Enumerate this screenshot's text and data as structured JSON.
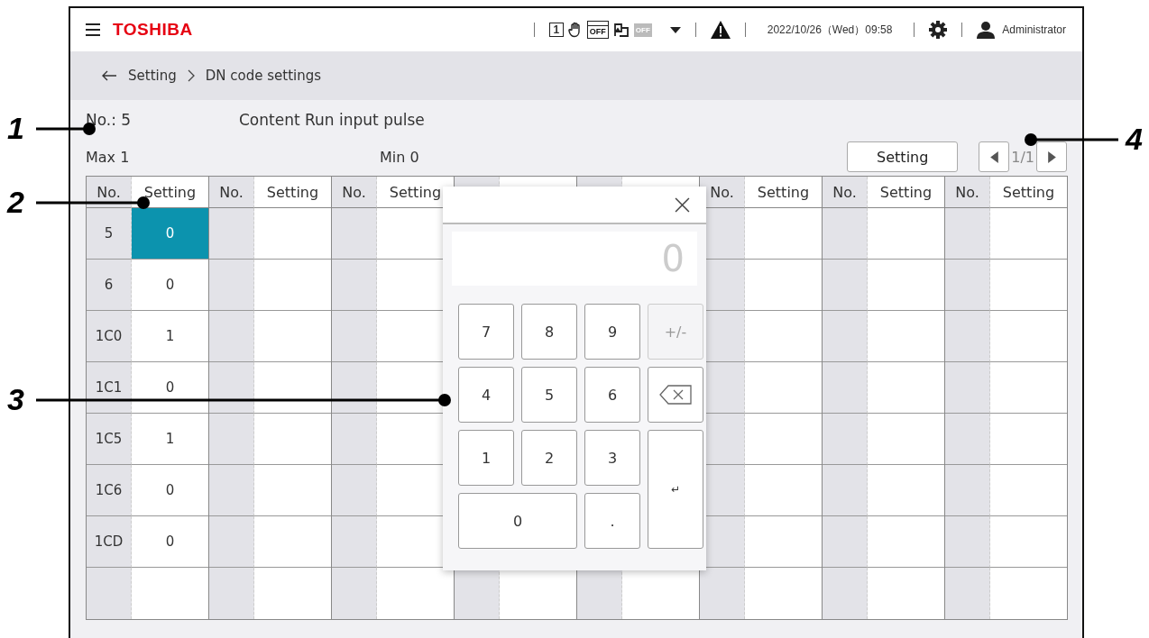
{
  "header": {
    "logo": "TOSHIBA",
    "status_icons": [
      {
        "kind": "number",
        "label": "1"
      },
      {
        "kind": "hand"
      },
      {
        "kind": "calendar",
        "label": "OFF"
      },
      {
        "kind": "schedule"
      },
      {
        "kind": "badge",
        "label": "OFF"
      }
    ],
    "datetime": "2022/10/26（Wed）09:58",
    "user": "Administrator"
  },
  "breadcrumb": [
    "Setting",
    "DN code settings"
  ],
  "info": {
    "number": "No.: 5",
    "content": "Content Run input pulse",
    "max": "Max 1",
    "min": "Min 0",
    "setting_button": "Setting",
    "page": "1/1"
  },
  "columns": [
    {
      "no_header": "No.",
      "setting_header": "Setting",
      "rows": [
        {
          "no": "5",
          "setting": "0",
          "selected": true
        },
        {
          "no": "6",
          "setting": "0",
          "selected": false
        },
        {
          "no": "1C0",
          "setting": "1",
          "selected": false
        },
        {
          "no": "1C1",
          "setting": "0",
          "selected": false
        },
        {
          "no": "1C5",
          "setting": "1",
          "selected": false
        },
        {
          "no": "1C6",
          "setting": "0",
          "selected": false
        },
        {
          "no": "1CD",
          "setting": "0",
          "selected": false
        }
      ]
    },
    {
      "no_header": "No.",
      "setting_header": "Setting"
    },
    {
      "no_header": "No.",
      "setting_header": "Setting"
    },
    {},
    {},
    {
      "no_header": "No.",
      "setting_header": "Setting"
    },
    {
      "no_header": "No.",
      "setting_header": "Setting"
    },
    {
      "no_header": "No.",
      "setting_header": "Setting"
    }
  ],
  "keypad": {
    "display": "0",
    "keys": [
      {
        "kind": "digit",
        "label": "7",
        "disabled": false
      },
      {
        "kind": "digit",
        "label": "8",
        "disabled": false
      },
      {
        "kind": "digit",
        "label": "9",
        "disabled": false
      },
      {
        "kind": "digit",
        "label": "+/-",
        "disabled": true
      },
      {
        "kind": "digit",
        "label": "4",
        "disabled": false
      },
      {
        "kind": "digit",
        "label": "5",
        "disabled": false
      },
      {
        "kind": "digit",
        "label": "6",
        "disabled": false
      },
      {
        "kind": "backspace",
        "disabled": false
      },
      {
        "kind": "digit",
        "label": "1",
        "disabled": false
      },
      {
        "kind": "digit",
        "label": "2",
        "disabled": false
      },
      {
        "kind": "digit",
        "label": "3",
        "disabled": false
      },
      {
        "kind": "enter",
        "label": "↵",
        "disabled": false
      },
      {
        "kind": "wide",
        "label": "0",
        "disabled": false
      },
      {
        "kind": "digit",
        "label": ".",
        "disabled": false
      }
    ]
  },
  "callouts": [
    {
      "label": "1"
    },
    {
      "label": "2"
    },
    {
      "label": "3"
    },
    {
      "label": "4"
    }
  ]
}
